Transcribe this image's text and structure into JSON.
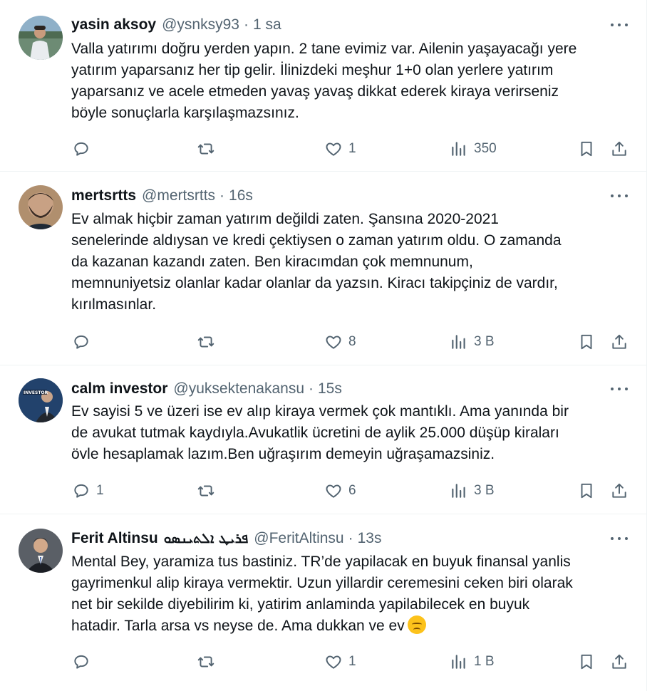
{
  "tweets": [
    {
      "name": "yasin aksoy",
      "name_extra": "",
      "handle": "@ysnksy93",
      "sep": "·",
      "time": "1 sa",
      "text": "Valla yatırımı doğru yerden yapın. 2 tane evimiz var.  Ailenin yaşayacağı yere\nyatırım yaparsanız her tip gelir. İlinizdeki meşhur 1+0 olan yerlere yatırım\nyaparsanız ve acele etmeden yavaş yavaş dikkat ederek kiraya verirseniz\nböyle sonuçlarla karşılaşmazsınız.",
      "reply_count": "",
      "repost_count": "",
      "like_count": "1",
      "view_count": "350"
    },
    {
      "name": "mertsrtts",
      "name_extra": "",
      "handle": "@mertsrtts",
      "sep": "·",
      "time": "16s",
      "text": "Ev almak hiçbir zaman yatırım değildi zaten. Şansına 2020-2021\nsenelerinde aldıysan ve kredi çektiysen o zaman yatırım oldu. O zamanda\nda kazanan kazandı zaten. Ben kiracımdan çok memnunum,\nmemnuniyetsiz olanlar kadar olanlar da yazsın. Kiracı takipçiniz de vardır,\nkırılmasınlar.",
      "reply_count": "",
      "repost_count": "",
      "like_count": "8",
      "view_count": "3 B"
    },
    {
      "name": "calm investor",
      "name_extra": "",
      "handle": "@yuksektenakansu",
      "sep": "·",
      "time": "15s",
      "text": "Ev sayisi 5 ve üzeri ise ev alıp kiraya vermek çok mantıklı. Ama yanında bir\nde avukat tutmak kaydıyla.Avukatlik ücretini de aylik 25.000 düşüp kiraları\növle hesaplamak lazım.Ben uğraşırım demeyin uğraşamazsiniz.",
      "reply_count": "1",
      "repost_count": "",
      "like_count": "6",
      "view_count": "3 B"
    },
    {
      "name": "Ferit Altinsu",
      "name_extra": "ܦܪܝܛ ܐܠܬܝܢܣܘ",
      "handle": "@FeritAltinsu",
      "sep": "·",
      "time": "13s",
      "text": "Mental Bey, yaramiza tus bastiniz. TR’de yapilacak en buyuk finansal yanlis\ngayrimenkul alip kiraya vermektir. Uzun yillardir ceremesini ceken biri olarak\nnet bir sekilde diyebilirim ki, yatirim anlaminda yapilabilecek en buyuk\nhatadir. Tarla arsa vs neyse de. Ama dukkan ve ev",
      "reply_count": "",
      "repost_count": "",
      "like_count": "1",
      "view_count": "1 B"
    }
  ],
  "avatars": [
    "avatar-lake-man",
    "avatar-bearded-man",
    "avatar-investor-suit",
    "avatar-man-in-suit"
  ],
  "emoji": "disappointed-face-emoji",
  "colors": {
    "text": "#0f1419",
    "muted": "#536471",
    "divider": "#eff3f4",
    "background": "#ffffff"
  }
}
